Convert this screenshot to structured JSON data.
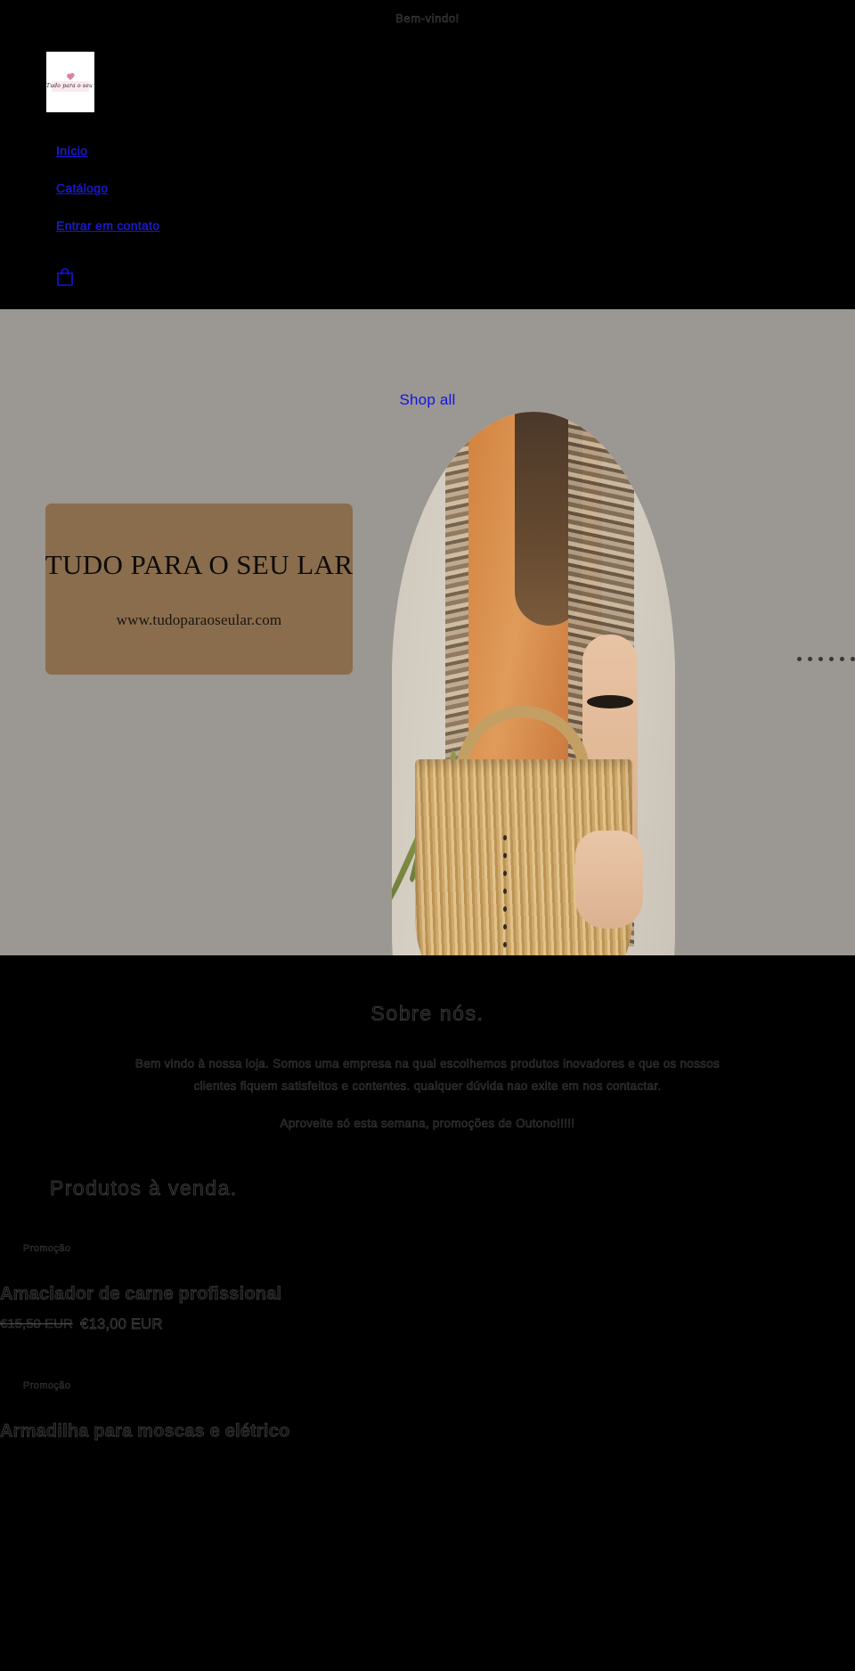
{
  "announcement": {
    "text": "Bem-vindo!"
  },
  "header": {
    "logo": {
      "alt": "Tudo para o seu lar",
      "script_text": "Tudo para o seu lar",
      "icon": "heart-icon"
    },
    "nav": [
      {
        "label": "Início",
        "name": "nav-inicio"
      },
      {
        "label": "Catálogo",
        "name": "nav-catalogo"
      },
      {
        "label": "Entrar em contato",
        "name": "nav-contato"
      }
    ],
    "cart": {
      "icon": "shopping-bag-icon",
      "label": "Carrinho"
    }
  },
  "hero": {
    "shop_all_label": "Shop all",
    "banner": {
      "title": "TUDO PARA O SEU LAR",
      "url": "www.tudoparaoseular.com",
      "card_color": "#8a6d4d"
    },
    "photo_alt": "Modelo com vestido laranja e bolsa de palha",
    "background_color": "#9b9792",
    "dots_horizontal_count": 6,
    "dots_vertical_count": 8
  },
  "about": {
    "title": "Sobre nós.",
    "body": "Bem vindo à nossa loja. Somos uma empresa na qual escolhemos produtos inovadores e que os nossos clientes fiquem satisfeitos e contentes. qualquer dúvida nao exite em nos contactar.",
    "promo": "Aproveite só esta semana, promoções de Outono!!!!!"
  },
  "products": {
    "title": "Produtos à venda.",
    "items": [
      {
        "badge": "Promoção",
        "name": "Amaciador de carne profissional",
        "price_old": "€15,50 EUR",
        "price_new": "€13,00 EUR"
      },
      {
        "badge": "Promoção",
        "name": "Armadilha para moscas e elétrico",
        "price_old": "",
        "price_new": ""
      }
    ]
  },
  "colors": {
    "link": "#1414e0",
    "page_bg": "#000000",
    "hero_bg": "#9b9792",
    "card": "#8a6d4d"
  }
}
